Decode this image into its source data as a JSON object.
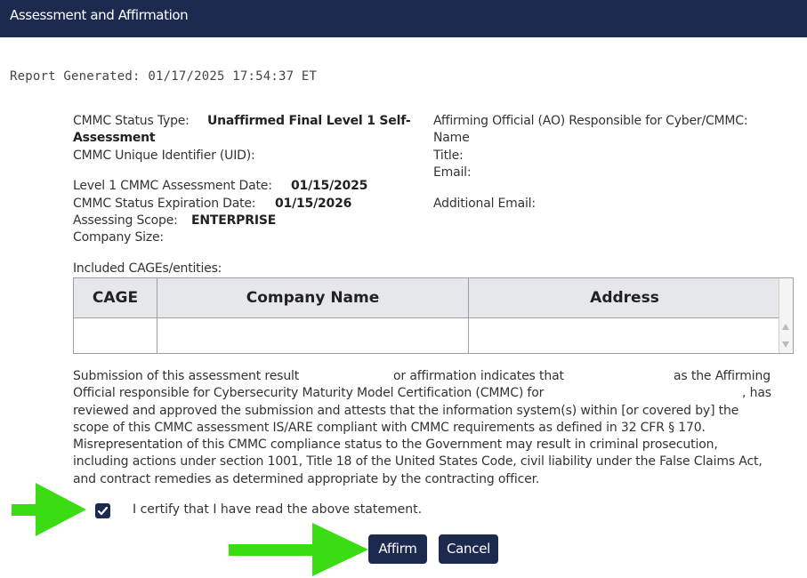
{
  "window": {
    "title": "Assessment and Affirmation"
  },
  "report": {
    "generated": "Report Generated: 01/17/2025 17:54:37 ET"
  },
  "details": {
    "status_type_label": "CMMC Status Type:",
    "status_type_value_line1": "Unaffirmed Final Level 1 Self-",
    "status_type_value_line2": "Assessment",
    "uid_label": "CMMC Unique Identifier (UID):",
    "assessment_date_label": "Level 1 CMMC Assessment Date:",
    "assessment_date_value": "01/15/2025",
    "expiration_label": "CMMC Status Expiration Date:",
    "expiration_value": "01/15/2026",
    "scope_label": "Assessing Scope:",
    "scope_value": "ENTERPRISE",
    "company_size_label": "Company Size:"
  },
  "official": {
    "heading": "Affirming Official (AO) Responsible for Cyber/CMMC:",
    "name_label": "Name",
    "title_label": "Title:",
    "email_label": "Email:",
    "additional_email_label": "Additional Email:"
  },
  "cages": {
    "caption": "Included CAGEs/entities:",
    "columns": [
      "CAGE",
      "Company Name",
      "Address"
    ],
    "rows": [
      [
        "",
        "",
        ""
      ]
    ]
  },
  "statement": {
    "line1_a": "Submission of this assessment result",
    "line1_b": "or affirmation indicates that",
    "line1_c": "as the Affirming",
    "line2_a": "Official responsible for Cybersecurity Maturity Model Certification (CMMC) for",
    "line2_b": ", has",
    "line3": "reviewed and approved the submission and attests that the information system(s) within [or covered by] the",
    "line4": "scope of this CMMC assessment IS/ARE compliant with CMMC requirements as defined in 32 CFR § 170.",
    "line5": "Misrepresentation of this CMMC compliance status to the Government may result in criminal prosecution,",
    "line6": "including actions under section 1001, Title 18 of the United States Code, civil liability under the False Claims Act,",
    "line7": "and contract remedies as determined appropriate by the contracting officer."
  },
  "certify": {
    "checked": true,
    "label": "I certify that I have read the above statement."
  },
  "actions": {
    "affirm_label": "Affirm",
    "cancel_label": "Cancel"
  },
  "colors": {
    "header_bg": "#1c2a4f",
    "button_bg": "#1c2a4f",
    "annotation_arrow": "#3bdc14"
  },
  "icons": {
    "checkbox": "checkmark-icon",
    "pointer_arrows": "right-arrow-icon"
  }
}
